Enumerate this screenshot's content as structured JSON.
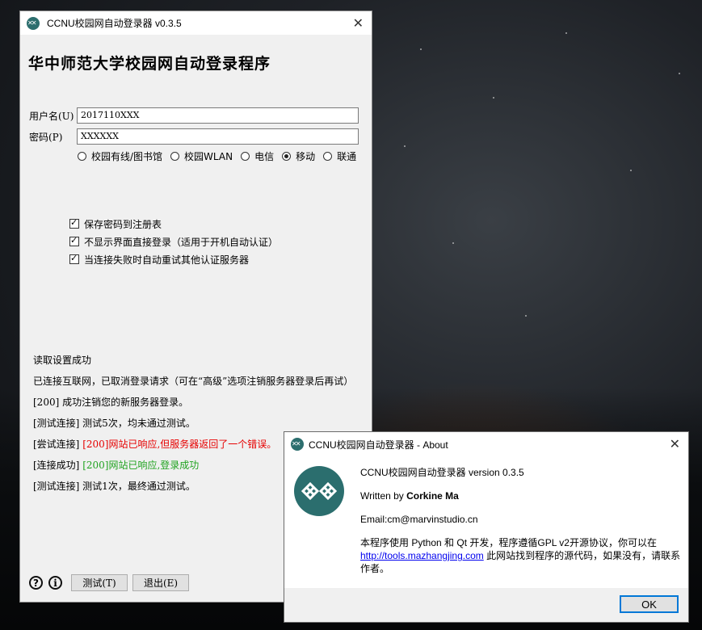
{
  "main": {
    "title": "CCNU校园网自动登录器 v0.3.5",
    "heading": "华中师范大学校园网自动登录程序",
    "username_label": "用户名(U)",
    "username_value": "2017110XXX",
    "password_label": "密码(P)",
    "password_value": "XXXXXX",
    "networks": [
      "校园有线/图书馆",
      "校园WLAN",
      "电信",
      "移动",
      "联通"
    ],
    "selected_network": "移动",
    "options": [
      "保存密码到注册表",
      "不显示界面直接登录（适用于开机自动认证）",
      "当连接失败时自动重试其他认证服务器"
    ],
    "log": {
      "l1": "读取设置成功",
      "l2": "已连接互联网，已取消登录请求（可在“高级”选项注销服务器登录后再试）",
      "l3": "[200] 成功注销您的新服务器登录。",
      "l4": "[测试连接] 测试5次，均未通过测试。",
      "l5_prefix": "[尝试连接]",
      "l5_msg": "[200]网站已响应,但服务器返回了一个错误。",
      "l6_prefix": "[连接成功]",
      "l6_msg": "[200]网站已响应,登录成功",
      "l7": "[测试连接] 测试1次，最终通过测试。"
    },
    "help_glyph": "?",
    "info_glyph": "i",
    "test_button": "测试(T)",
    "exit_button": "退出(E)"
  },
  "about": {
    "title": "CCNU校园网自动登录器 - About",
    "version_line": "CCNU校园网自动登录器 version 0.3.5",
    "written_by_prefix": "Written by ",
    "author": "Corkine Ma",
    "email": "Email:cm@marvinstudio.cn",
    "desc_1": "本程序使用 Python 和 Qt 开发，程序遵循GPL v2开源协议，你可以在",
    "link": "http://tools.mazhangjing.com",
    "desc_2": " 此网站找到程序的源代码，如果没有，请联系作者。",
    "ok_button": "OK"
  },
  "colors": {
    "accent": "#0078d7",
    "logo_teal": "#2b6e6e",
    "log_error": "#e60000",
    "log_success": "#21a321"
  },
  "icons": [
    "app-logo-icon",
    "close-icon",
    "help-icon",
    "info-icon"
  ]
}
